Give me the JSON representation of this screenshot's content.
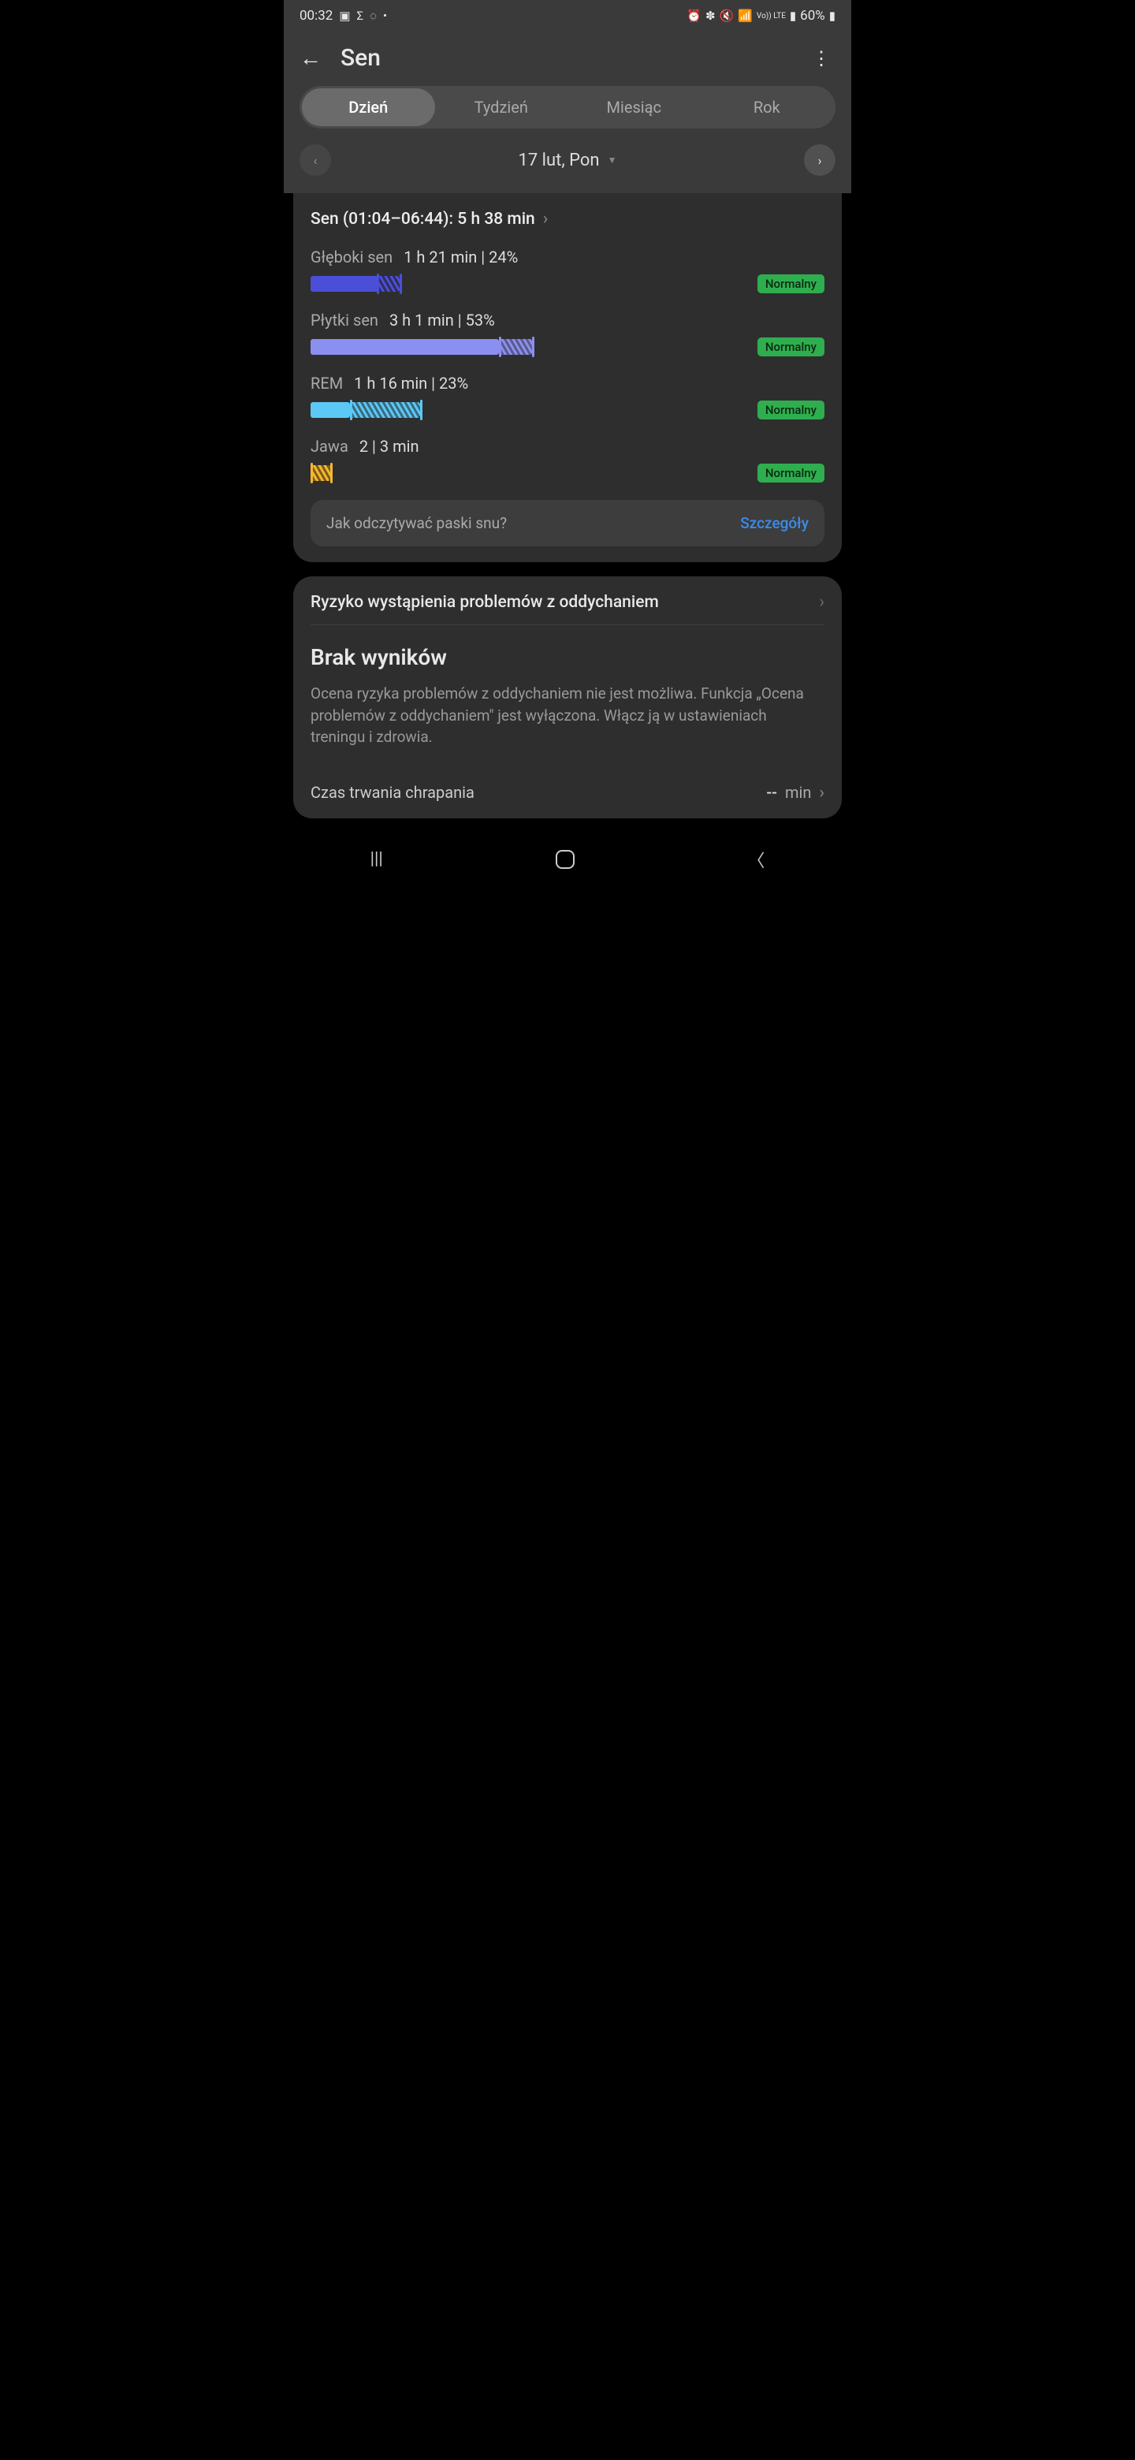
{
  "status": {
    "time": "00:32",
    "battery": "60%"
  },
  "header": {
    "title": "Sen"
  },
  "tabs": {
    "day": "Dzień",
    "week": "Tydzień",
    "month": "Miesiąc",
    "year": "Rok"
  },
  "date": "17 lut, Pon",
  "session": {
    "label": "Sen (01:04–06:44): 5 h 38 min"
  },
  "stages": {
    "deep": {
      "name": "Głęboki sen",
      "value": "1 h 21 min | 24%",
      "badge": "Normalny"
    },
    "light": {
      "name": "Płytki sen",
      "value": "3 h 1 min | 53%",
      "badge": "Normalny"
    },
    "rem": {
      "name": "REM",
      "value": "1 h 16 min | 23%",
      "badge": "Normalny"
    },
    "awake": {
      "name": "Jawa",
      "value": "2 | 3 min",
      "badge": "Normalny"
    }
  },
  "info": {
    "question": "Jak odczytywać paski snu?",
    "link": "Szczegóły"
  },
  "breathing": {
    "title": "Ryzyko wystąpienia problemów z oddychaniem",
    "heading": "Brak wyników",
    "body": "Ocena ryzyka problemów z oddychaniem nie jest możliwa. Funkcja „Ocena problemów z oddychaniem\" jest wyłączona. Włącz ją w ustawieniach treningu i zdrowia."
  },
  "snoring": {
    "label": "Czas trwania chrapania",
    "value": "--",
    "unit": "min"
  },
  "chart_data": {
    "type": "bar",
    "title": "Sleep stages",
    "unit_percent": true,
    "series": [
      {
        "name": "Głęboki sen",
        "percent": 24,
        "duration_min": 81,
        "status": "Normalny"
      },
      {
        "name": "Płytki sen",
        "percent": 53,
        "duration_min": 181,
        "status": "Normalny"
      },
      {
        "name": "REM",
        "percent": 23,
        "duration_min": 76,
        "status": "Normalny"
      },
      {
        "name": "Jawa",
        "count": 2,
        "duration_min": 3,
        "status": "Normalny"
      }
    ],
    "total_min": 338,
    "range": "01:04–06:44"
  }
}
